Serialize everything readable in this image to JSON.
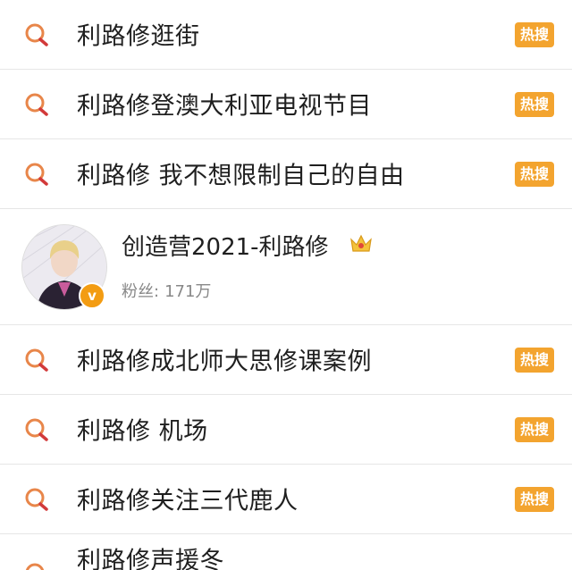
{
  "hot_badge": "热搜",
  "top_results": [
    {
      "label": "利路修逛街"
    },
    {
      "label": "利路修登澳大利亚电视节目"
    },
    {
      "label": "利路修 我不想限制自己的自由"
    }
  ],
  "user_card": {
    "name": "创造营2021-利路修",
    "fans_label": "粉丝:",
    "fans_count": "171万",
    "verified_mark": "v"
  },
  "bottom_results": [
    {
      "label": "利路修成北师大思修课案例"
    },
    {
      "label": "利路修 机场"
    },
    {
      "label": "利路修关注三代鹿人"
    }
  ],
  "partial_result": {
    "label": "利路修声援冬"
  },
  "colors": {
    "hot_badge_bg": "#f3a42f",
    "search_icon": "#e8864a",
    "verified_bg": "#f39c12"
  }
}
